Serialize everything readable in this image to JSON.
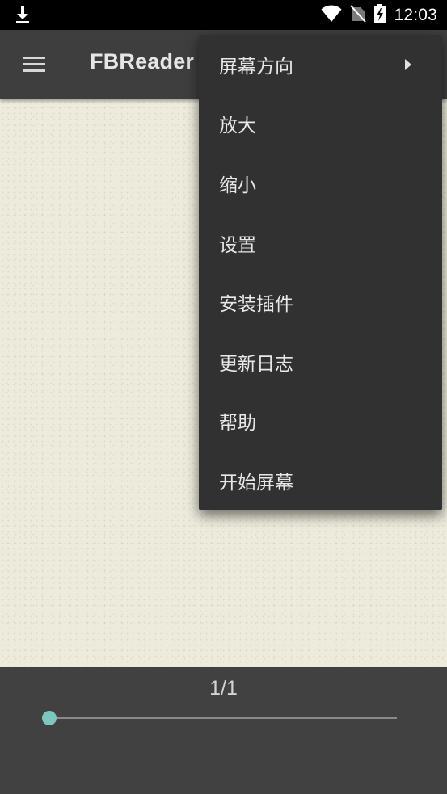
{
  "status_bar": {
    "time": "12:03",
    "icons": [
      "download-icon",
      "wifi-icon",
      "no-sim-icon",
      "battery-charging-icon"
    ]
  },
  "toolbar": {
    "title": "FBReader",
    "menu_icon": "hamburger-menu-icon"
  },
  "menu": {
    "items": [
      {
        "label": "屏幕方向",
        "has_submenu": true
      },
      {
        "label": "放大"
      },
      {
        "label": "缩小"
      },
      {
        "label": "设置"
      },
      {
        "label": "安装插件"
      },
      {
        "label": "更新日志"
      },
      {
        "label": "帮助"
      },
      {
        "label": "开始屏幕"
      }
    ]
  },
  "bottom_panel": {
    "page_indicator": "1/1",
    "progress": 0
  },
  "colors": {
    "toolbar": "#3e3e3e",
    "menu": "#313131",
    "page": "#ecebdc",
    "bottom_panel": "#414141",
    "slider_accent": "#7cc6bd"
  }
}
